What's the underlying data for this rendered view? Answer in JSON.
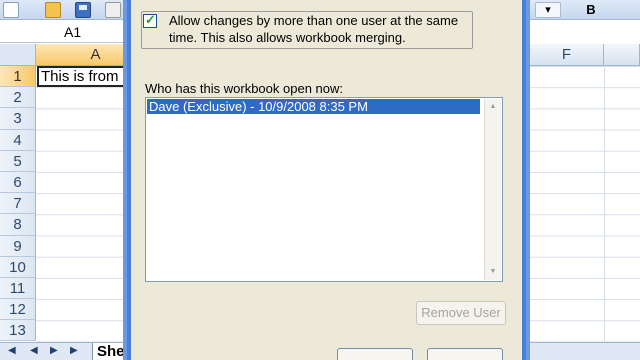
{
  "excel": {
    "name_box": "A1",
    "column_headers": [
      "A",
      "F"
    ],
    "row_numbers": [
      "1",
      "2",
      "3",
      "4",
      "5",
      "6",
      "7",
      "8",
      "9",
      "10",
      "11",
      "12",
      "13"
    ],
    "cell_a1": "This is from",
    "sheet_tab": "She",
    "toolbar_bold": "B",
    "nav_arrows": [
      "◀",
      "◀",
      "▶",
      "▶"
    ]
  },
  "dialog": {
    "allow_changes_label": "Allow changes by more than one user at the same time.  This also allows workbook merging.",
    "allow_changes_checked": true,
    "check_glyph": "✓",
    "who_label": "Who has this workbook open now:",
    "users": [
      "Dave (Exclusive) - 10/9/2008 8:35 PM"
    ],
    "remove_user_button": "Remove User"
  }
}
